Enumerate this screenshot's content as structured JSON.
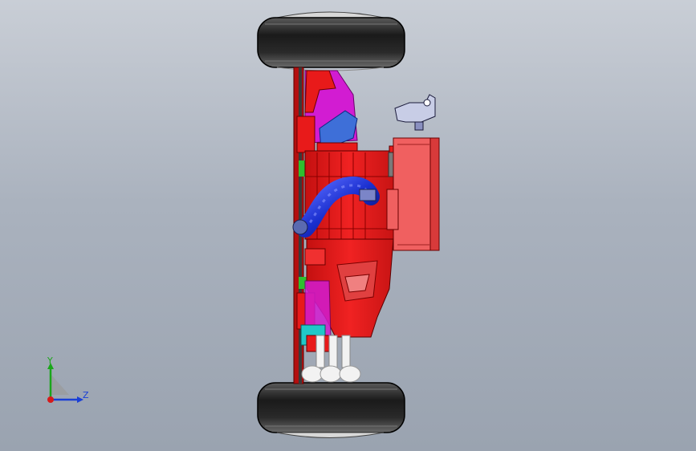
{
  "viewport": {
    "background_top": "#c9ced6",
    "background_bottom": "#9aa3b0"
  },
  "model": {
    "description_icon": "cad-assembly",
    "colors": {
      "frame": "#e81a1a",
      "frame_dark": "#b30f0f",
      "housing": "#f06060",
      "tire": "#1e1e1e",
      "hub": "#d8d8d8",
      "hose": "#1a2fcf",
      "magenta_part": "#d21cd2",
      "green_part": "#2fbf2f",
      "cyan_part": "#20c8c8",
      "bracket": "#c8cde6",
      "white_part": "#f2f2f2"
    }
  },
  "triad": {
    "y_label": "Y",
    "z_label": "Z",
    "y_color": "#1aa61a",
    "z_color": "#1a3fd6",
    "origin_color": "#d61a1a"
  }
}
